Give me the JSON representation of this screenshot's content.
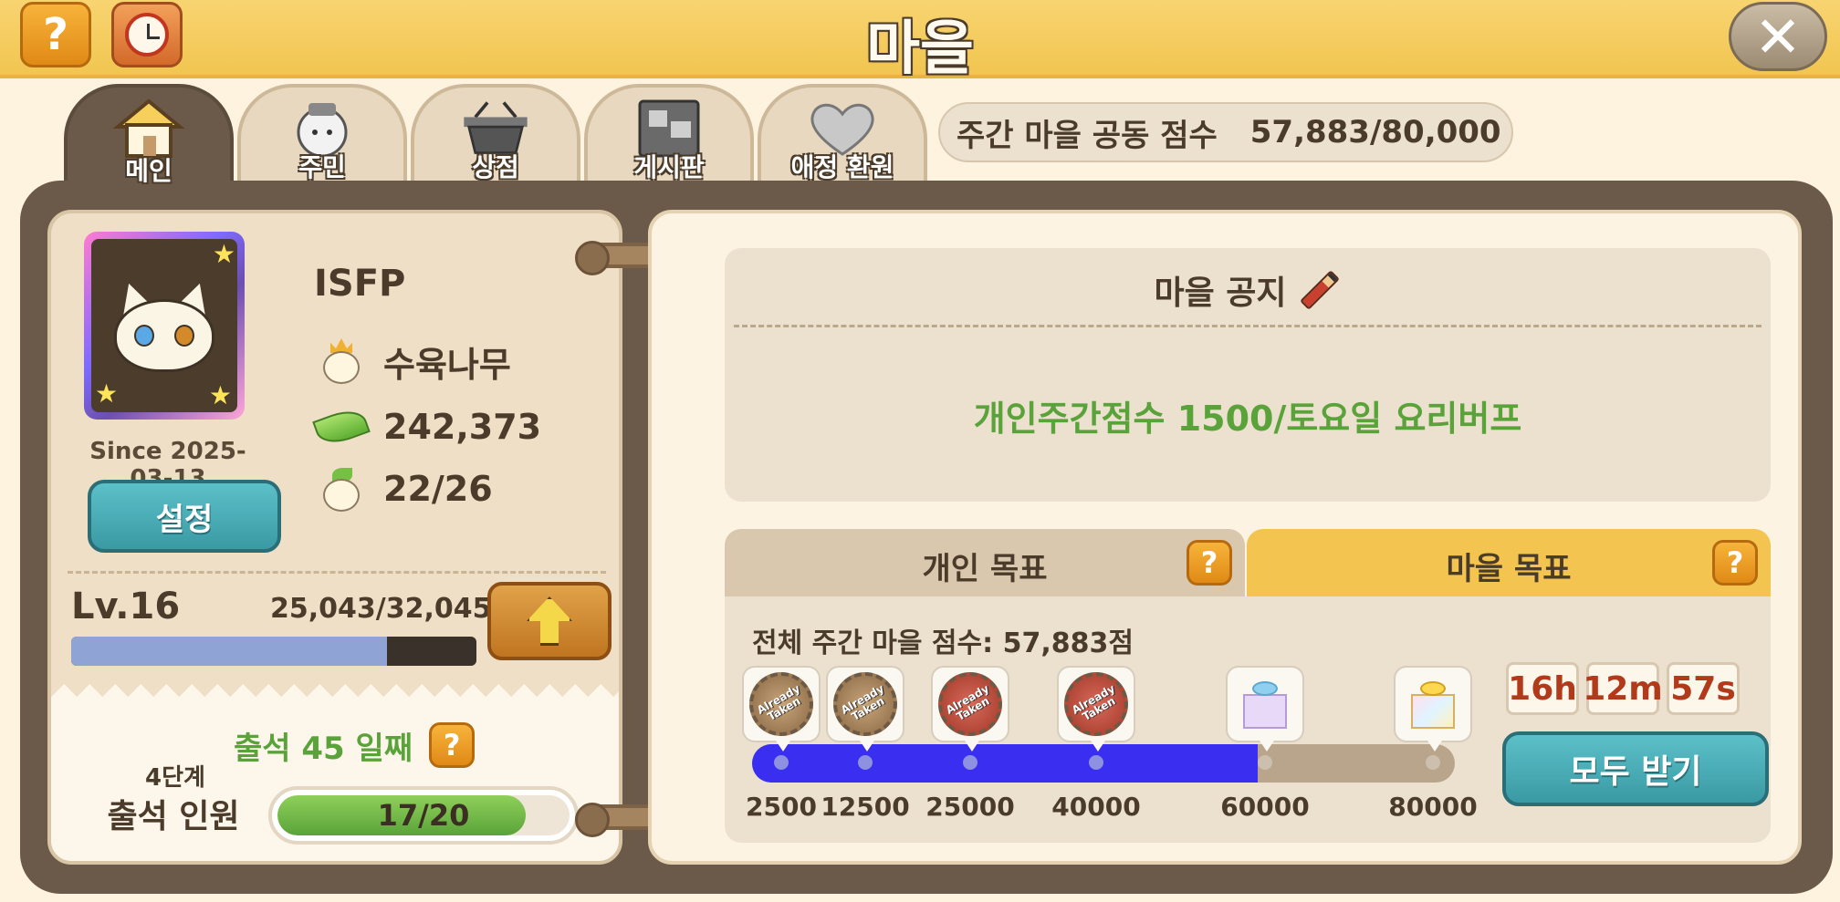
{
  "header": {
    "title": "마을",
    "help_label": "?",
    "close_label": "✕"
  },
  "tabs": [
    {
      "label": "메인",
      "icon": "house-icon",
      "active": true
    },
    {
      "label": "주민",
      "icon": "resident-icon",
      "active": false
    },
    {
      "label": "상점",
      "icon": "basket-icon",
      "active": false
    },
    {
      "label": "게시판",
      "icon": "board-icon",
      "active": false
    },
    {
      "label": "애정 환원",
      "icon": "heart-icon",
      "active": false
    }
  ],
  "weekly_score": {
    "label": "주간 마을 공동 점수",
    "value": "57,883/80,000"
  },
  "profile": {
    "name": "ISFP",
    "since": "Since 2025-03-13",
    "settings_label": "설정",
    "leader": "수육나무",
    "leaves": "242,373",
    "members": "22/26"
  },
  "level": {
    "label": "Lv.16",
    "exp": "25,043/32,045",
    "progress": 0.78
  },
  "attendance": {
    "day_label": "출석 45 일째",
    "stage": "4단계",
    "label": "출석 인원",
    "count": "17/20",
    "progress": 0.85
  },
  "notice": {
    "title": "마을 공지",
    "text": "개인주간점수 1500/토요일 요리버프"
  },
  "goals": {
    "personal_tab": "개인 목표",
    "village_tab": "마을 목표",
    "help": "?",
    "total_label": "전체 주간 마을 점수: 57,883점",
    "progress": 0.72,
    "milestones": [
      {
        "value": "2500",
        "status": "Already Taken",
        "reward": "medal"
      },
      {
        "value": "12500",
        "status": "Already Taken",
        "reward": "medal"
      },
      {
        "value": "25000",
        "status": "Already Taken",
        "reward": "medal"
      },
      {
        "value": "40000",
        "status": "Already Taken",
        "reward": "medal"
      },
      {
        "value": "60000",
        "status": "",
        "reward": "gift"
      },
      {
        "value": "80000",
        "status": "",
        "reward": "gold-gift"
      }
    ],
    "timer": {
      "h": "16h",
      "m": "12m",
      "s": "57s"
    },
    "claim_all": "모두 받기"
  },
  "colors": {
    "accent": "#f3c550",
    "teal": "#3a9aa4",
    "green_text": "#5aa33a",
    "progress_blue": "#3a2ef0"
  }
}
